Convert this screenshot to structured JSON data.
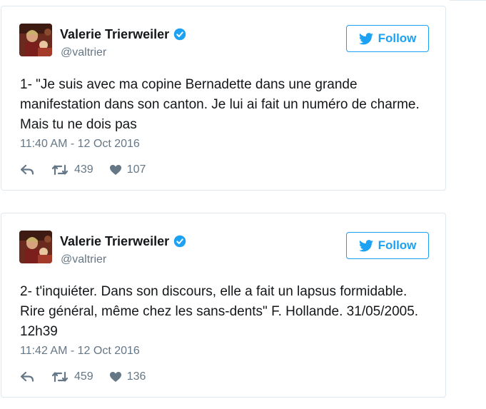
{
  "tweets": [
    {
      "author": {
        "name": "Valerie Trierweiler",
        "handle": "@valtrier"
      },
      "follow_label": "Follow",
      "text": "1- \"Je suis avec ma copine Bernadette dans une grande manifestation dans son canton. Je lui ai fait un numéro de charme. Mais tu ne dois pas",
      "timestamp": "11:40 AM - 12 Oct 2016",
      "retweets": "439",
      "likes": "107"
    },
    {
      "author": {
        "name": "Valerie Trierweiler",
        "handle": "@valtrier"
      },
      "follow_label": "Follow",
      "text": "2- t'inquiéter. Dans son discours, elle a fait un lapsus formidable. Rire général, même chez les sans-dents\" F. Hollande. 31/05/2005. 12h39",
      "timestamp": "11:42 AM - 12 Oct 2016",
      "retweets": "459",
      "likes": "136"
    }
  ],
  "icons": {
    "verified": "verified-badge-icon",
    "follow": "twitter-bird-icon",
    "reply": "reply-icon",
    "retweet": "retweet-icon",
    "like": "heart-icon"
  },
  "colors": {
    "accent": "#1da1f2",
    "secondary_text": "#657786",
    "border": "#e1e8ed"
  }
}
